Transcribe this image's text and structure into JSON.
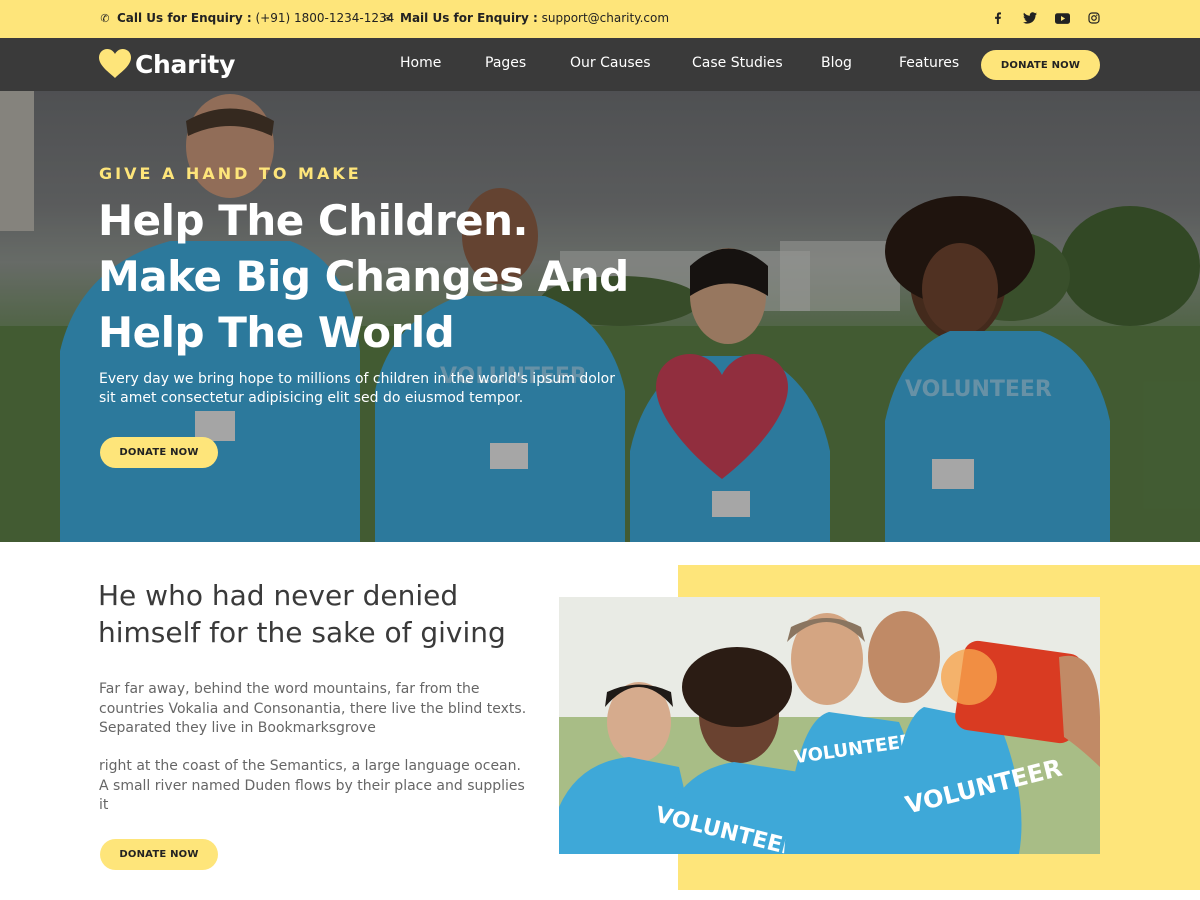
{
  "topbar": {
    "phone_label": "Call Us for Enquiry :",
    "phone_value": "(+91) 1800-1234-1234",
    "mail_label": "Mail Us for Enquiry :",
    "mail_value": "support@charity.com",
    "social": [
      "facebook-icon",
      "twitter-icon",
      "youtube-icon",
      "instagram-icon"
    ]
  },
  "brand": {
    "name": "Charity"
  },
  "nav": {
    "items": [
      "Home",
      "Pages",
      "Our Causes",
      "Case Studies",
      "Blog",
      "Features"
    ],
    "donate": "DONATE NOW"
  },
  "hero": {
    "eyebrow": "GIVE A HAND TO MAKE",
    "title": "Help The Children. Make Big Changes And Help The World",
    "description": "Every day we bring hope to millions of children in the world's ipsum dolor sit amet consectetur adipisicing elit sed do eiusmod tempor.",
    "button": "DONATE NOW",
    "shirt_text": "VOLUNTEER"
  },
  "about": {
    "title": "He who had never denied himself for the sake of giving",
    "paragraph1": "Far far away, behind the word mountains, far from the countries Vokalia and Consonantia, there live the blind texts. Separated they live in Bookmarksgrove",
    "paragraph2": "right at the coast of the Semantics, a large language ocean. A small river named Duden flows by their place and supplies it",
    "button": "DONATE NOW",
    "shirt_text": "VOLUNTEER"
  },
  "colors": {
    "accent": "#fee57a",
    "nav_bg": "#3a3a3a",
    "shirt": "#3ea8d8",
    "heart": "#c94156"
  }
}
